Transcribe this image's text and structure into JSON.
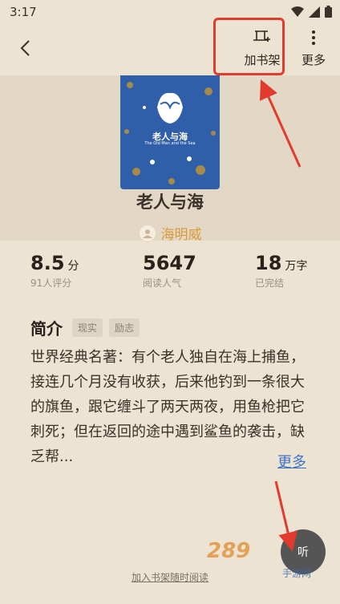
{
  "status_bar": {
    "time": "3:17"
  },
  "top_bar": {
    "add_shelf_label": "加书架",
    "more_label": "更多"
  },
  "book": {
    "cover_title": "老人与海",
    "cover_subtitle": "The Old Man and the Sea",
    "title": "老人与海",
    "author": "海明威"
  },
  "stats": [
    {
      "value": "8.5",
      "unit": "分",
      "caption": "91人评分"
    },
    {
      "value": "5647",
      "unit": "",
      "caption": "阅读人气"
    },
    {
      "value": "18",
      "unit": "万字",
      "caption": "已完结"
    }
  ],
  "intro": {
    "heading": "简介",
    "tags": [
      "现实",
      "励志"
    ],
    "text": "世界经典名著：有个老人独自在海上捕鱼，接连几个月没有收获，后来他钓到一条很大的旗鱼，跟它缠斗了两天两夜，用鱼枪把它刺死；但在返回的途中遇到鲨鱼的袭击，缺乏帮...",
    "more_label": "更多"
  },
  "float_button": {
    "label": "听"
  },
  "watermark": {
    "text": "289",
    "sub": "手游网"
  },
  "bottom_link": "加入书架随时阅读",
  "colors": {
    "accent_red": "#e23b2e",
    "link_blue": "#3f72c4",
    "author_gold": "#d99a3a",
    "background": "#ece3d3"
  }
}
